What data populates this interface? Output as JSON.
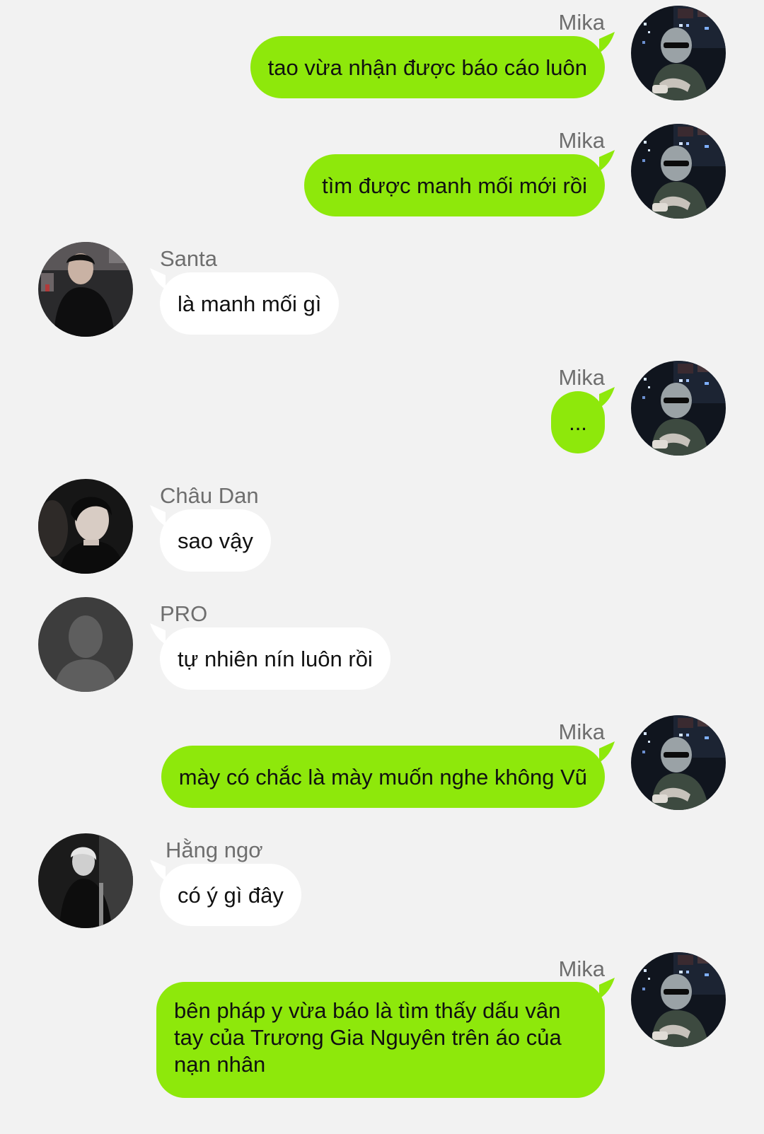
{
  "colors": {
    "background": "#f2f2f2",
    "outgoing_bubble": "#8ee80b",
    "incoming_bubble": "#ffffff",
    "name_text": "#6e6e6e"
  },
  "messages": [
    {
      "sender": "Mika",
      "side": "right",
      "text": "tao vừa nhận được báo cáo luôn",
      "avatar": "mika-avatar"
    },
    {
      "sender": "Mika",
      "side": "right",
      "text": "tìm được manh mối mới rồi",
      "avatar": "mika-avatar"
    },
    {
      "sender": "Santa",
      "side": "left",
      "text": "là manh mối gì",
      "avatar": "santa-avatar"
    },
    {
      "sender": "Mika",
      "side": "right",
      "text": "...",
      "avatar": "mika-avatar"
    },
    {
      "sender": "Châu Dan",
      "side": "left",
      "text": "sao vậy",
      "avatar": "chau-dan-avatar"
    },
    {
      "sender": "PRO",
      "side": "left",
      "text": "tự nhiên nín luôn rồi",
      "avatar": "default-user-avatar"
    },
    {
      "sender": "Mika",
      "side": "right",
      "text": "mày có chắc là mày muốn nghe không Vũ",
      "avatar": "mika-avatar"
    },
    {
      "sender": "Hằng ngơ",
      "side": "left",
      "text": "có ý gì đây",
      "avatar": "hang-ngo-avatar"
    },
    {
      "sender": "Mika",
      "side": "right",
      "text": "bên pháp y vừa báo là tìm thấy dấu vân tay của Trương Gia Nguyên trên áo của nạn nhân",
      "avatar": "mika-avatar"
    }
  ]
}
